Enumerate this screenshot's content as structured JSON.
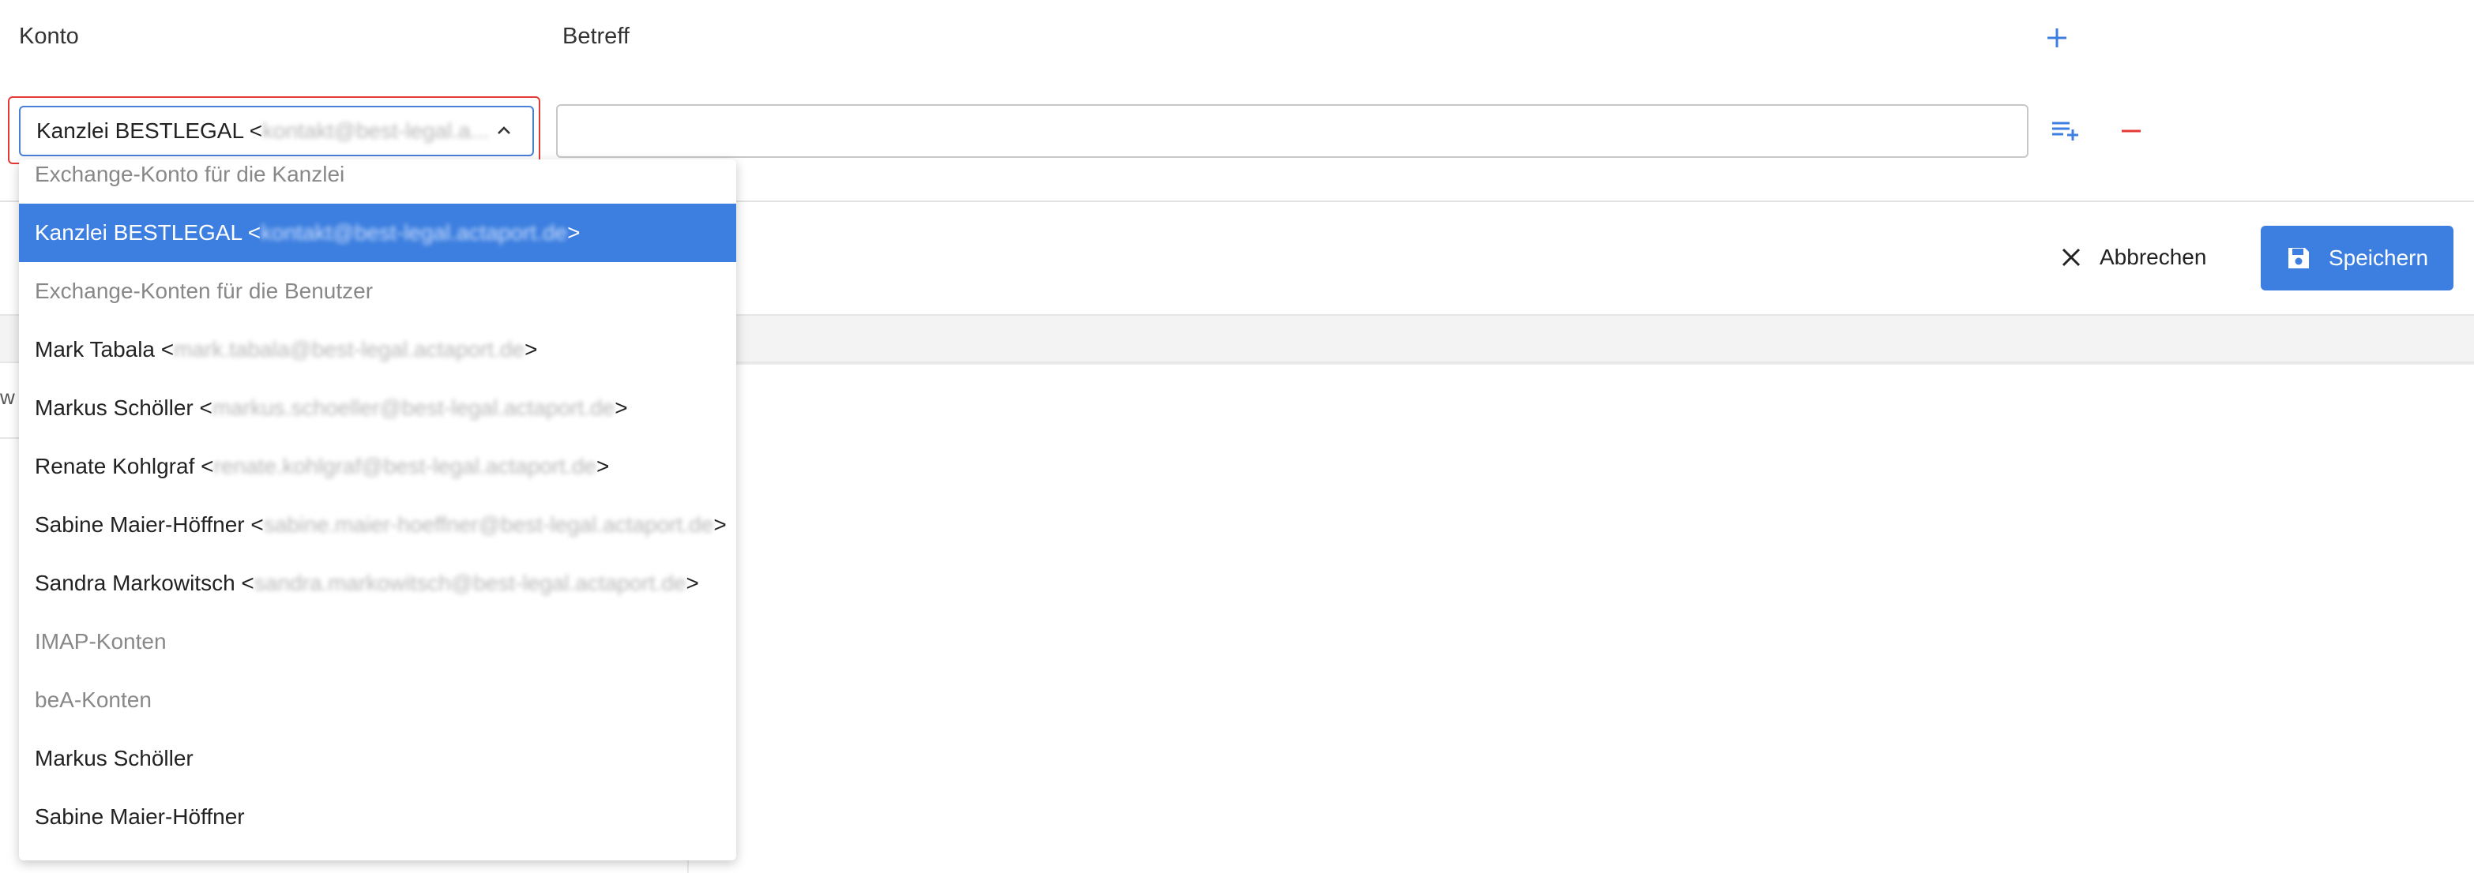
{
  "form": {
    "konto_label": "Konto",
    "betreff_label": "Betreff",
    "selected_account_name": "Kanzlei BESTLEGAL <",
    "selected_account_email": "kontakt@best-legal.a...",
    "betreff_value": "",
    "betreff_placeholder": ""
  },
  "toolbar": {
    "cancel_label": "Abbrechen",
    "save_label": "Speichern"
  },
  "dropdown": {
    "items": [
      {
        "type": "group",
        "label": "Exchange-Konto für die Kanzlei"
      },
      {
        "type": "option",
        "name": "Kanzlei BESTLEGAL <",
        "email": "kontakt@best-legal.actaport.de",
        "suffix": ">",
        "selected": true
      },
      {
        "type": "group",
        "label": "Exchange-Konten für die Benutzer"
      },
      {
        "type": "option",
        "name": "Mark Tabala <",
        "email": "mark.tabala@best-legal.actaport.de",
        "suffix": ">"
      },
      {
        "type": "option",
        "name": "Markus Schöller <",
        "email": "markus.schoeller@best-legal.actaport.de",
        "suffix": ">"
      },
      {
        "type": "option",
        "name": "Renate Kohlgraf <",
        "email": "renate.kohlgraf@best-legal.actaport.de",
        "suffix": ">"
      },
      {
        "type": "option",
        "name": "Sabine Maier-Höffner <",
        "email": "sabine.maier-hoeffner@best-legal.actaport.de",
        "suffix": ">"
      },
      {
        "type": "option",
        "name": "Sandra Markowitsch <",
        "email": "sandra.markowitsch@best-legal.actaport.de",
        "suffix": ">"
      },
      {
        "type": "group",
        "label": "IMAP-Konten"
      },
      {
        "type": "group",
        "label": "beA-Konten"
      },
      {
        "type": "option",
        "name": "Markus Schöller",
        "email": "",
        "suffix": ""
      },
      {
        "type": "option",
        "name": "Sabine Maier-Höffner",
        "email": "",
        "suffix": ""
      }
    ]
  },
  "background": {
    "stub_char": "w"
  },
  "icons": {
    "add": "plus-icon",
    "add_row": "playlist-add-icon",
    "remove": "minus-icon",
    "cancel": "close-icon",
    "save": "floppy-disk-icon",
    "expand": "chevron-up-icon"
  },
  "colors": {
    "accent": "#3d7fe0",
    "focus_outline": "#e53935",
    "remove": "#e53935"
  }
}
